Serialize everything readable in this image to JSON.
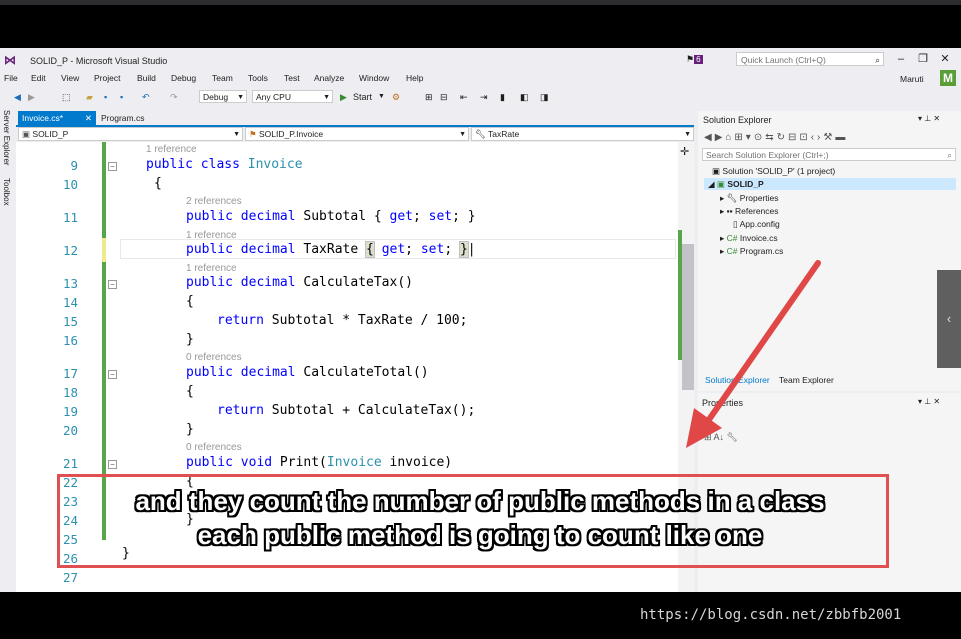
{
  "window": {
    "title": "SOLID_P - Microsoft Visual Studio",
    "notification_count": "6",
    "quick_launch_placeholder": "Quick Launch (Ctrl+Q)",
    "user": "Maruti",
    "avatar_letter": "M"
  },
  "menu": [
    "File",
    "Edit",
    "View",
    "Project",
    "Build",
    "Debug",
    "Team",
    "Tools",
    "Test",
    "Analyze",
    "Window",
    "Help"
  ],
  "toolbar": {
    "config": "Debug",
    "platform": "Any CPU",
    "start_label": "Start"
  },
  "side_rail": {
    "server_explorer": "Server Explorer",
    "toolbox": "Toolbox"
  },
  "tabs": [
    {
      "label": "Invoice.cs*"
    },
    {
      "label": "Program.cs"
    }
  ],
  "navbar": {
    "project": "SOLID_P",
    "class": "SOLID_P.Invoice",
    "member": "TaxRate"
  },
  "editor": {
    "lines": [
      {
        "ref": "1 reference",
        "num": "9",
        "code": "public class Invoice"
      },
      {
        "num": "10",
        "code": "{"
      },
      {
        "ref": "2 references",
        "num": "11",
        "code": "public decimal Subtotal { get; set; }"
      },
      {
        "ref": "1 reference",
        "num": "12",
        "code": "public decimal TaxRate { get; set; }"
      },
      {
        "ref": "1 reference",
        "num": "13",
        "code": "public decimal CalculateTax()"
      },
      {
        "num": "14",
        "code": "{"
      },
      {
        "num": "15",
        "code": "return Subtotal * TaxRate / 100;"
      },
      {
        "num": "16",
        "code": "}"
      },
      {
        "ref": "0 references",
        "num": "17",
        "code": "public decimal CalculateTotal()"
      },
      {
        "num": "18",
        "code": "{"
      },
      {
        "num": "19",
        "code": "return Subtotal + CalculateTax();"
      },
      {
        "num": "20",
        "code": "}"
      },
      {
        "ref": "0 references",
        "num": "21",
        "code": "public void Print(Invoice invoice)"
      },
      {
        "num": "22",
        "code": "{"
      },
      {
        "num": "23",
        "code": ""
      },
      {
        "num": "24",
        "code": "}"
      },
      {
        "num": "25",
        "code": "}"
      },
      {
        "num": "26",
        "code": ""
      },
      {
        "num": "27",
        "code": ""
      }
    ]
  },
  "solution_explorer": {
    "title": "Solution Explorer",
    "search_placeholder": "Search Solution Explorer (Ctrl+;)",
    "tree": [
      "Solution 'SOLID_P' (1 project)",
      "SOLID_P",
      "Properties",
      "References",
      "App.config",
      "Invoice.cs",
      "Program.cs"
    ],
    "bottom_tabs": [
      "Solution Explorer",
      "Team Explorer"
    ]
  },
  "properties": {
    "title": "Properties"
  },
  "subtitle": {
    "line1": "and they count the number of public methods in a class",
    "line2": "each public method is going to count like one"
  },
  "watermark": "https://blog.csdn.net/zbbfb2001",
  "colors": {
    "accent": "#007acc",
    "keyword": "#0000ff",
    "type": "#2b91af",
    "arrow": "#e04848"
  }
}
